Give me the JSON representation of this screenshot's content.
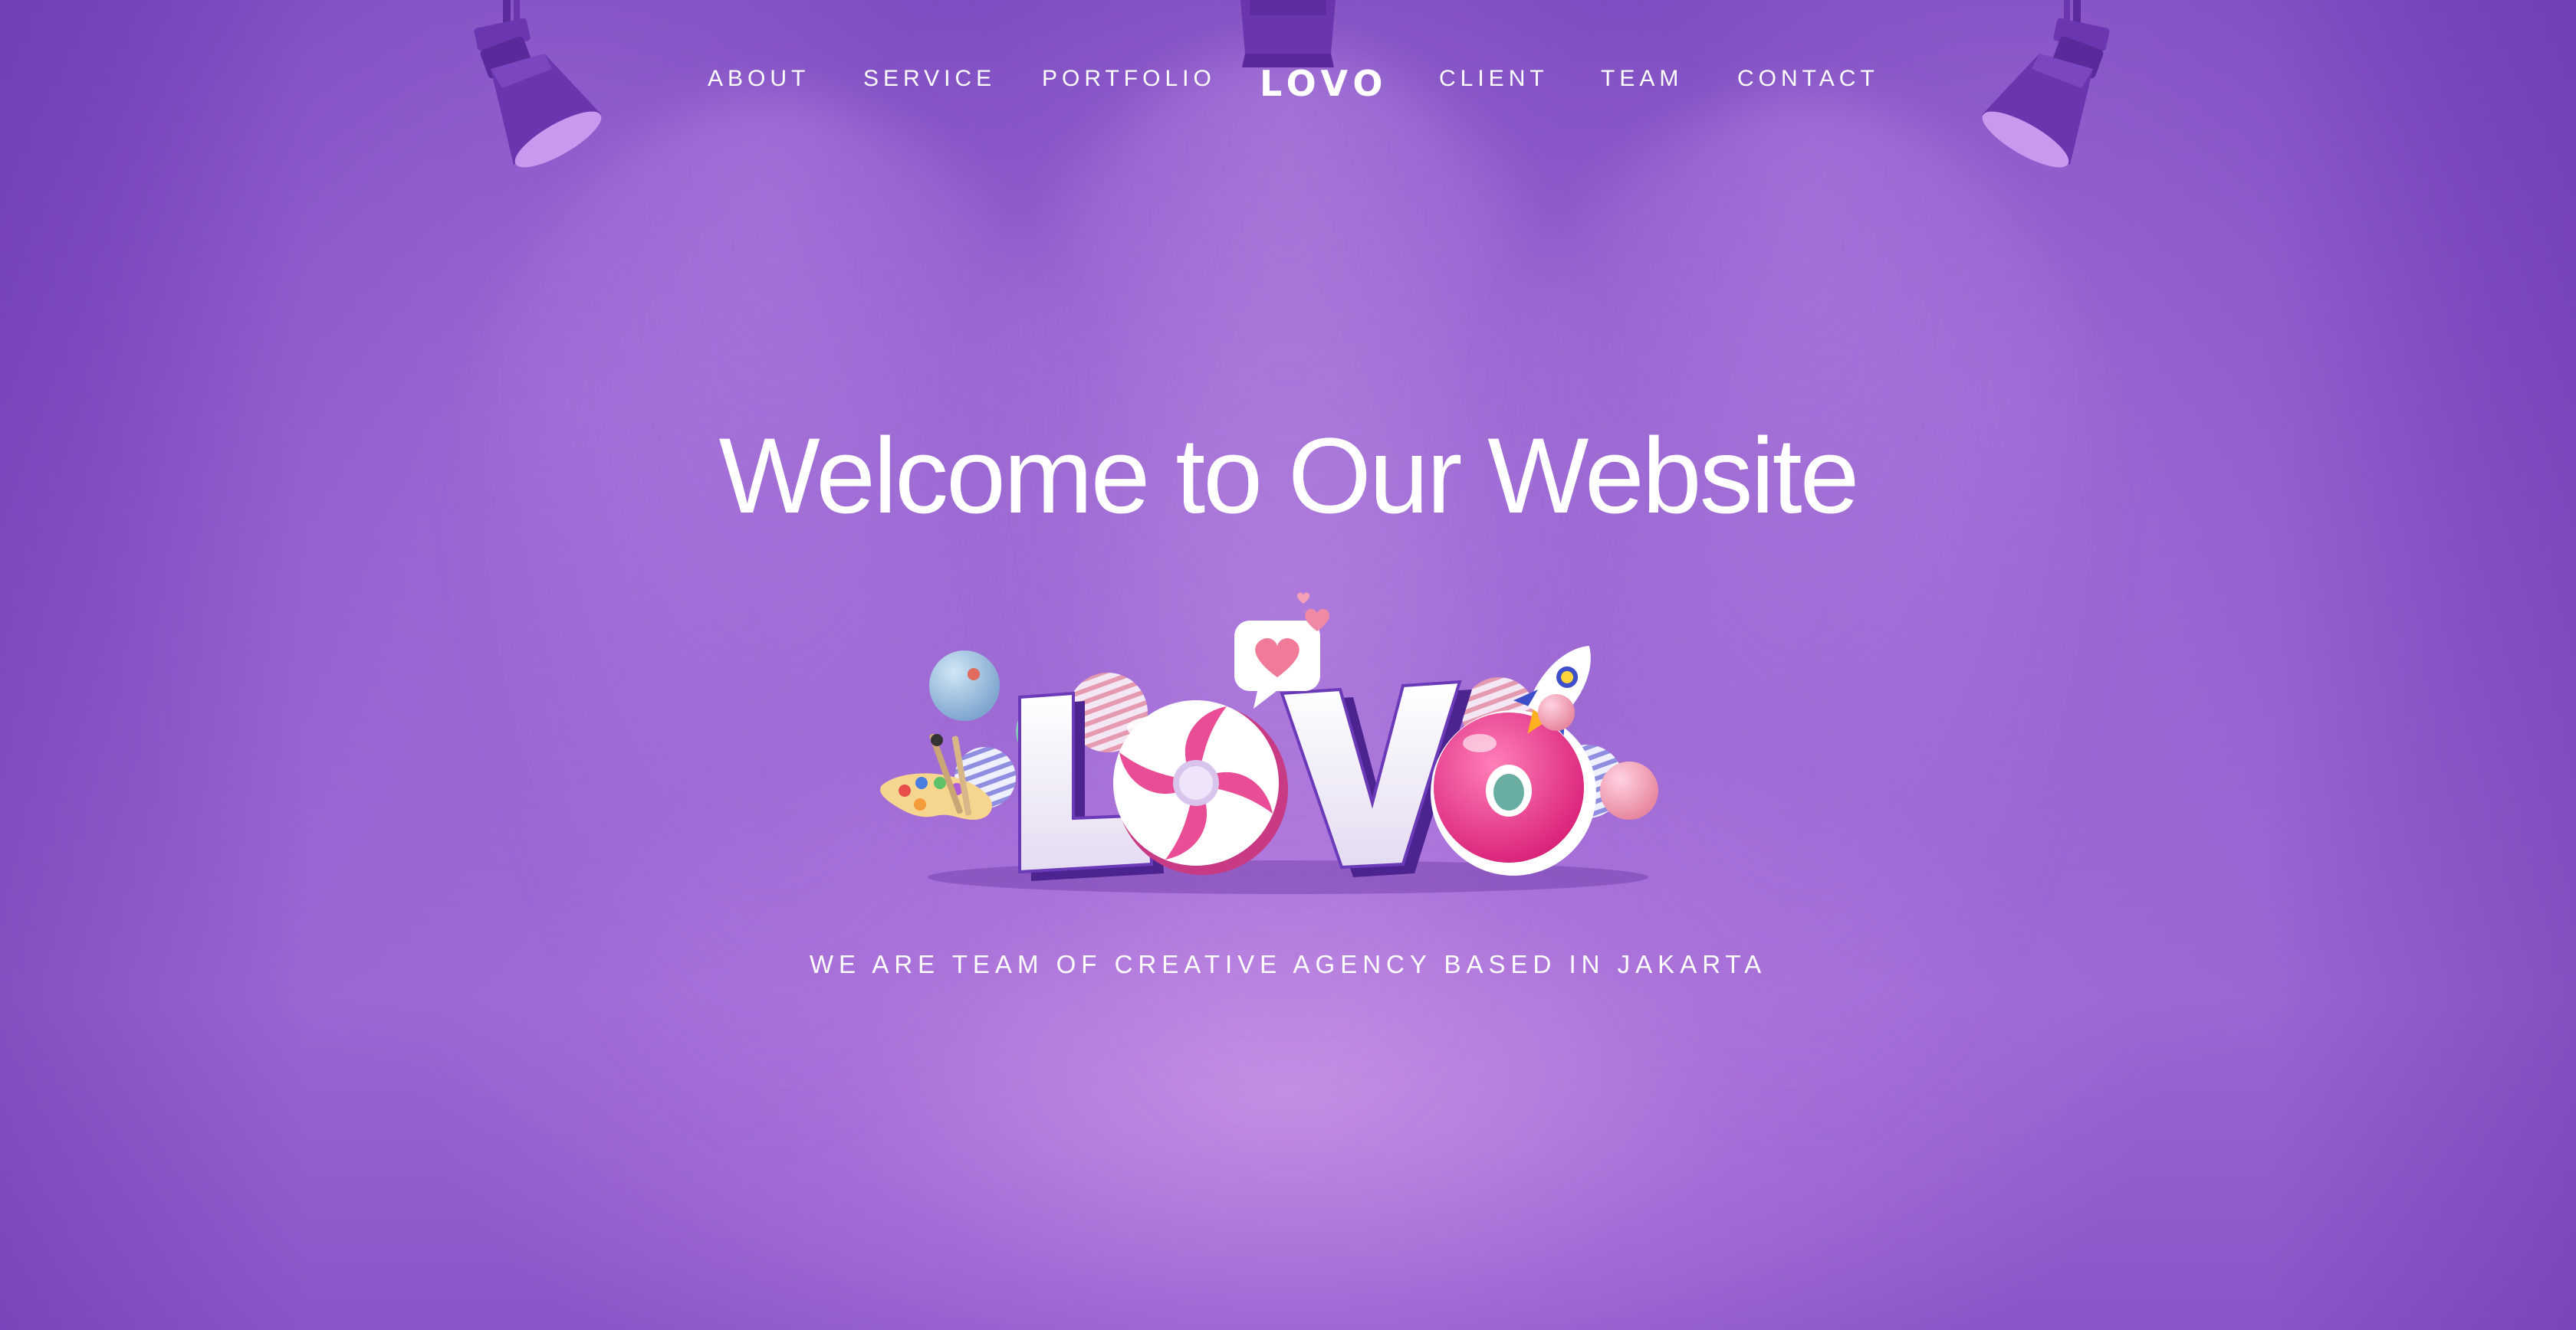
{
  "nav": {
    "about": "ABOUT",
    "service": "SERVICE",
    "portfolio": "PORTFOLIO",
    "logo": "LOVO",
    "client": "CLIENT",
    "team": "TEAM",
    "contact": "CONTACT"
  },
  "hero": {
    "title": "Welcome to Our Website",
    "subtitle": "WE ARE TEAM OF CREATIVE AGENCY BASED IN JAKARTA",
    "logo_art": {
      "letters": [
        "L",
        "O",
        "V",
        "O"
      ]
    }
  },
  "colors": {
    "background": "#8e5bcc",
    "text": "#ffffff",
    "lamp": "#6a36ad",
    "lamp_lens": "#c79af0",
    "logo_pink": "#e8408f",
    "logo_purple": "#4b2490"
  },
  "icons": [
    "spotlight-lamp-icon",
    "heart-chat-icon",
    "rocket-icon",
    "paint-palette-icon"
  ]
}
